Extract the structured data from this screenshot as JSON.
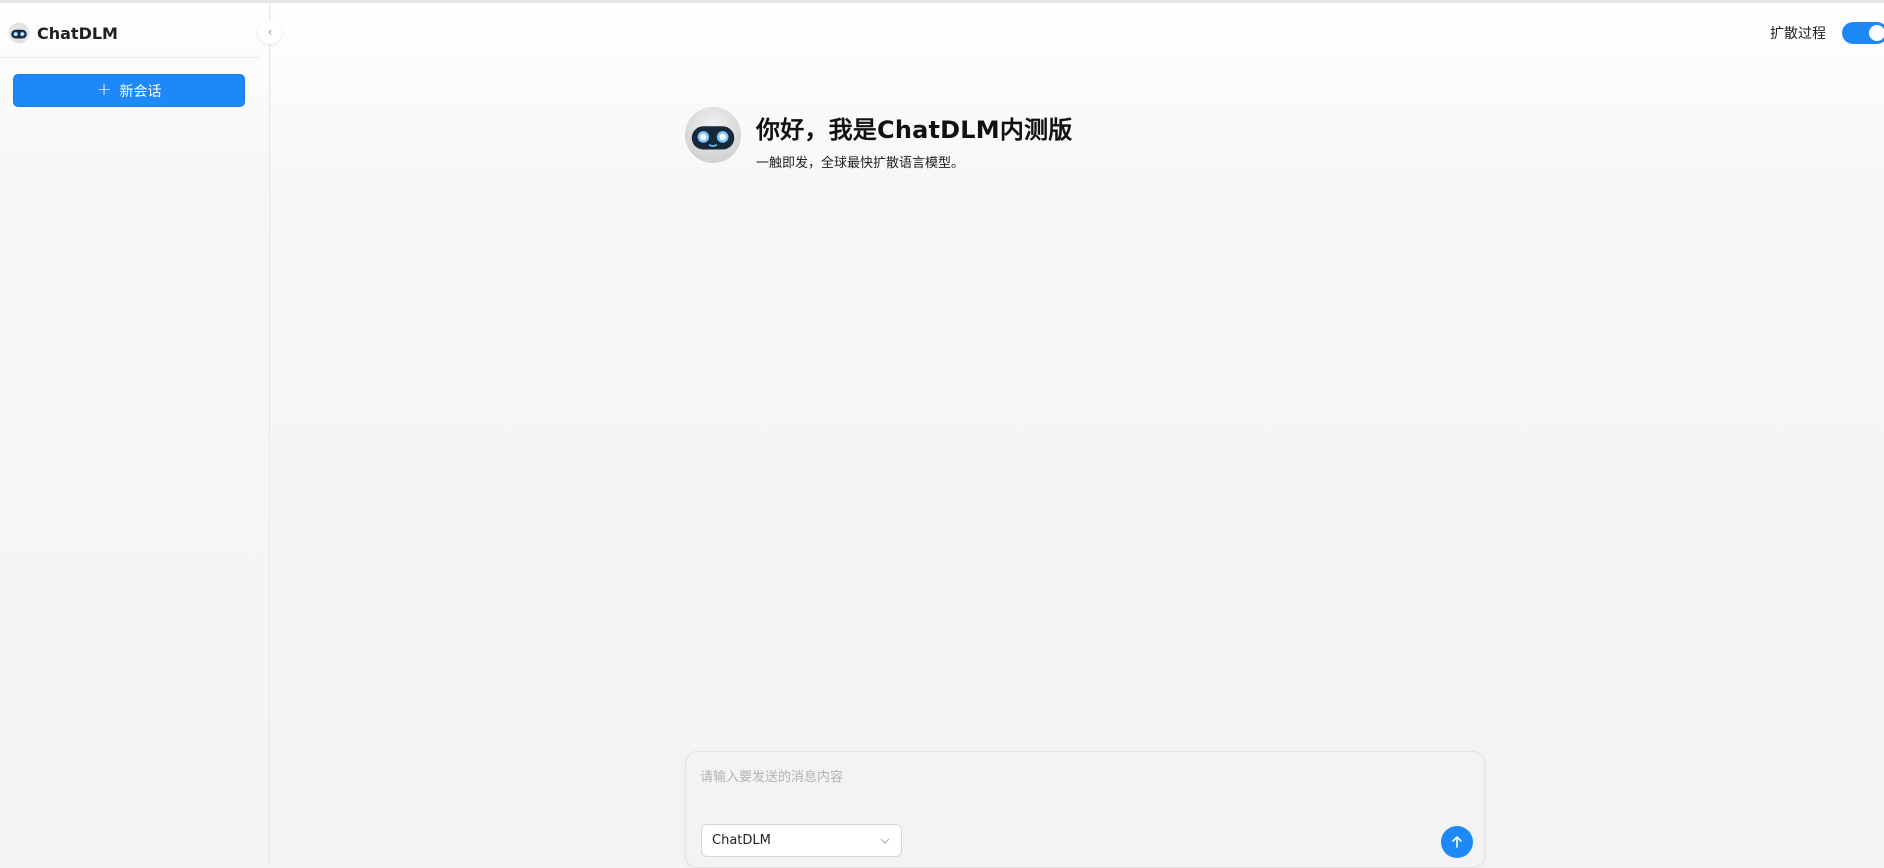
{
  "brand": {
    "name": "ChatDLM",
    "logo_icon": "robot-face-icon"
  },
  "sidebar": {
    "new_chat_label": "新会话",
    "new_chat_icon": "plus-icon",
    "collapse_icon": "chevron-left-icon"
  },
  "header": {
    "toggle_label": "扩散过程",
    "toggle_on": true
  },
  "welcome": {
    "title": "你好，我是ChatDLM内测版",
    "subtitle": "一触即发，全球最快扩散语言模型。",
    "avatar_icon": "robot-face-icon"
  },
  "composer": {
    "placeholder": "请输入要发送的消息内容",
    "value": "",
    "model_selected": "ChatDLM",
    "send_icon": "arrow-up-icon"
  },
  "colors": {
    "accent": "#1e88f7",
    "background": "#f4f4f4"
  }
}
